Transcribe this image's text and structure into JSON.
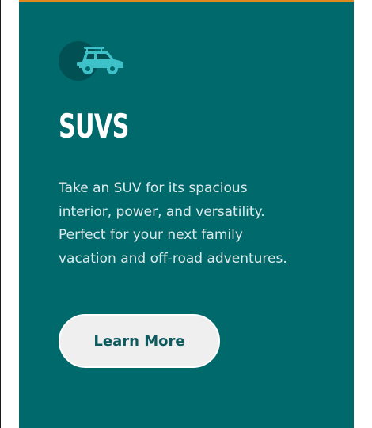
{
  "card": {
    "icon": "suv-car-icon",
    "title": "SUVS",
    "description": "Take an SUV for its spacious interior, power, and versatility. Perfect for your next family vacation and off-road adventures.",
    "button_label": "Learn More"
  },
  "colors": {
    "card_background": "#00696c",
    "accent_top_border": "#e0891d",
    "icon_circle": "#005054",
    "icon_car": "#3fc1c9",
    "button_background": "#efefef",
    "button_text": "#0e5a5e"
  }
}
